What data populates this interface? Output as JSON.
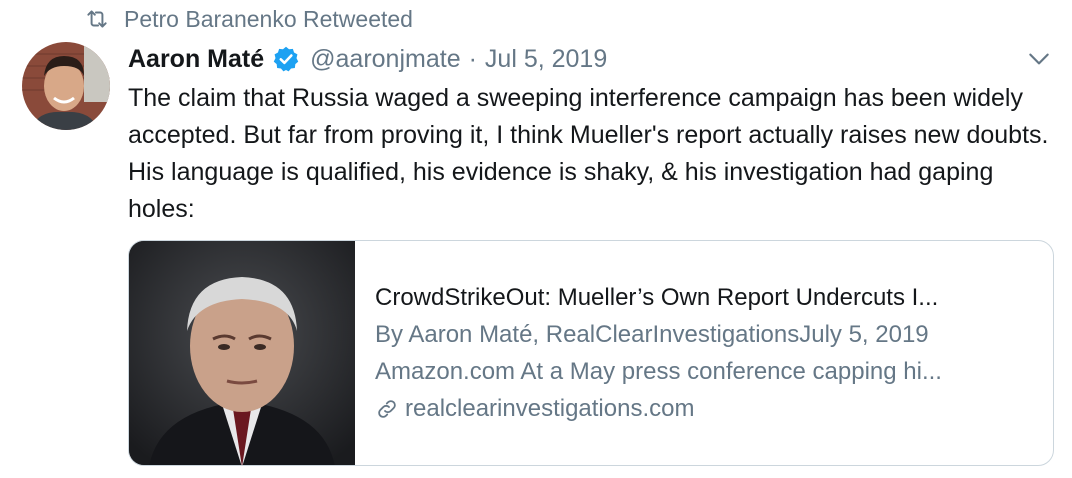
{
  "retweet": {
    "label": "Petro Baranenko Retweeted",
    "icon": "retweet-icon"
  },
  "tweet": {
    "author_name": "Aaron Maté",
    "verified": true,
    "handle": "@aaronjmate",
    "separator": "·",
    "date": "Jul 5, 2019",
    "text": "The claim that Russia waged a sweeping interference campaign has been widely accepted. But far from proving it, I think Mueller's report actually raises new doubts. His language is qualified, his evidence is shaky, & his investigation had gaping holes:"
  },
  "card": {
    "title": "CrowdStrikeOut: Mueller’s Own Report Undercuts I...",
    "byline": "By Aaron Maté, RealClearInvestigationsJuly 5, 2019",
    "description": "Amazon.com At a May press conference capping hi...",
    "url": "realclearinvestigations.com",
    "link_icon": "link-icon"
  },
  "colors": {
    "text": "#14171a",
    "secondary": "#657786",
    "verified": "#1da1f2",
    "border": "#ccd6dd"
  }
}
